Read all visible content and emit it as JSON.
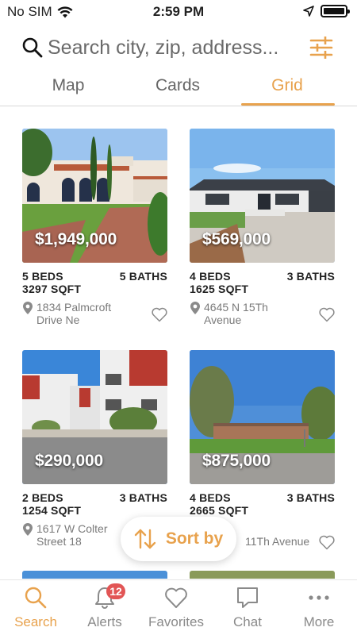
{
  "status_bar": {
    "carrier": "No SIM",
    "time": "2:59 PM"
  },
  "search": {
    "placeholder": "Search city, zip, address..."
  },
  "tabs": [
    {
      "label": "Map",
      "active": false
    },
    {
      "label": "Cards",
      "active": false
    },
    {
      "label": "Grid",
      "active": true
    }
  ],
  "listings": [
    {
      "price": "$1,949,000",
      "beds": "5 BEDS",
      "baths": "5 BATHS",
      "sqft": "3297 SQFT",
      "address_line1": "1834 Palmcroft",
      "address_line2": "Drive Ne"
    },
    {
      "price": "$569,000",
      "beds": "4 BEDS",
      "baths": "3 BATHS",
      "sqft": "1625 SQFT",
      "address_line1": "4645 N 15Th",
      "address_line2": "Avenue"
    },
    {
      "price": "$290,000",
      "beds": "2 BEDS",
      "baths": "3 BATHS",
      "sqft": "1254 SQFT",
      "address_line1": "1617 W Colter",
      "address_line2": "Street 18"
    },
    {
      "price": "$875,000",
      "beds": "4 BEDS",
      "baths": "3 BATHS",
      "sqft": "2665 SQFT",
      "address_line1": "11Th Avenue",
      "address_line2": ""
    }
  ],
  "sort": {
    "label": "Sort by"
  },
  "bottom_nav": [
    {
      "label": "Search",
      "icon": "search-icon",
      "active": true
    },
    {
      "label": "Alerts",
      "icon": "bell-icon",
      "badge": "12"
    },
    {
      "label": "Favorites",
      "icon": "heart-icon"
    },
    {
      "label": "Chat",
      "icon": "chat-icon"
    },
    {
      "label": "More",
      "icon": "more-icon"
    }
  ],
  "colors": {
    "accent": "#e8a24d",
    "badge": "#e25555",
    "muted": "#8a8a8a"
  }
}
